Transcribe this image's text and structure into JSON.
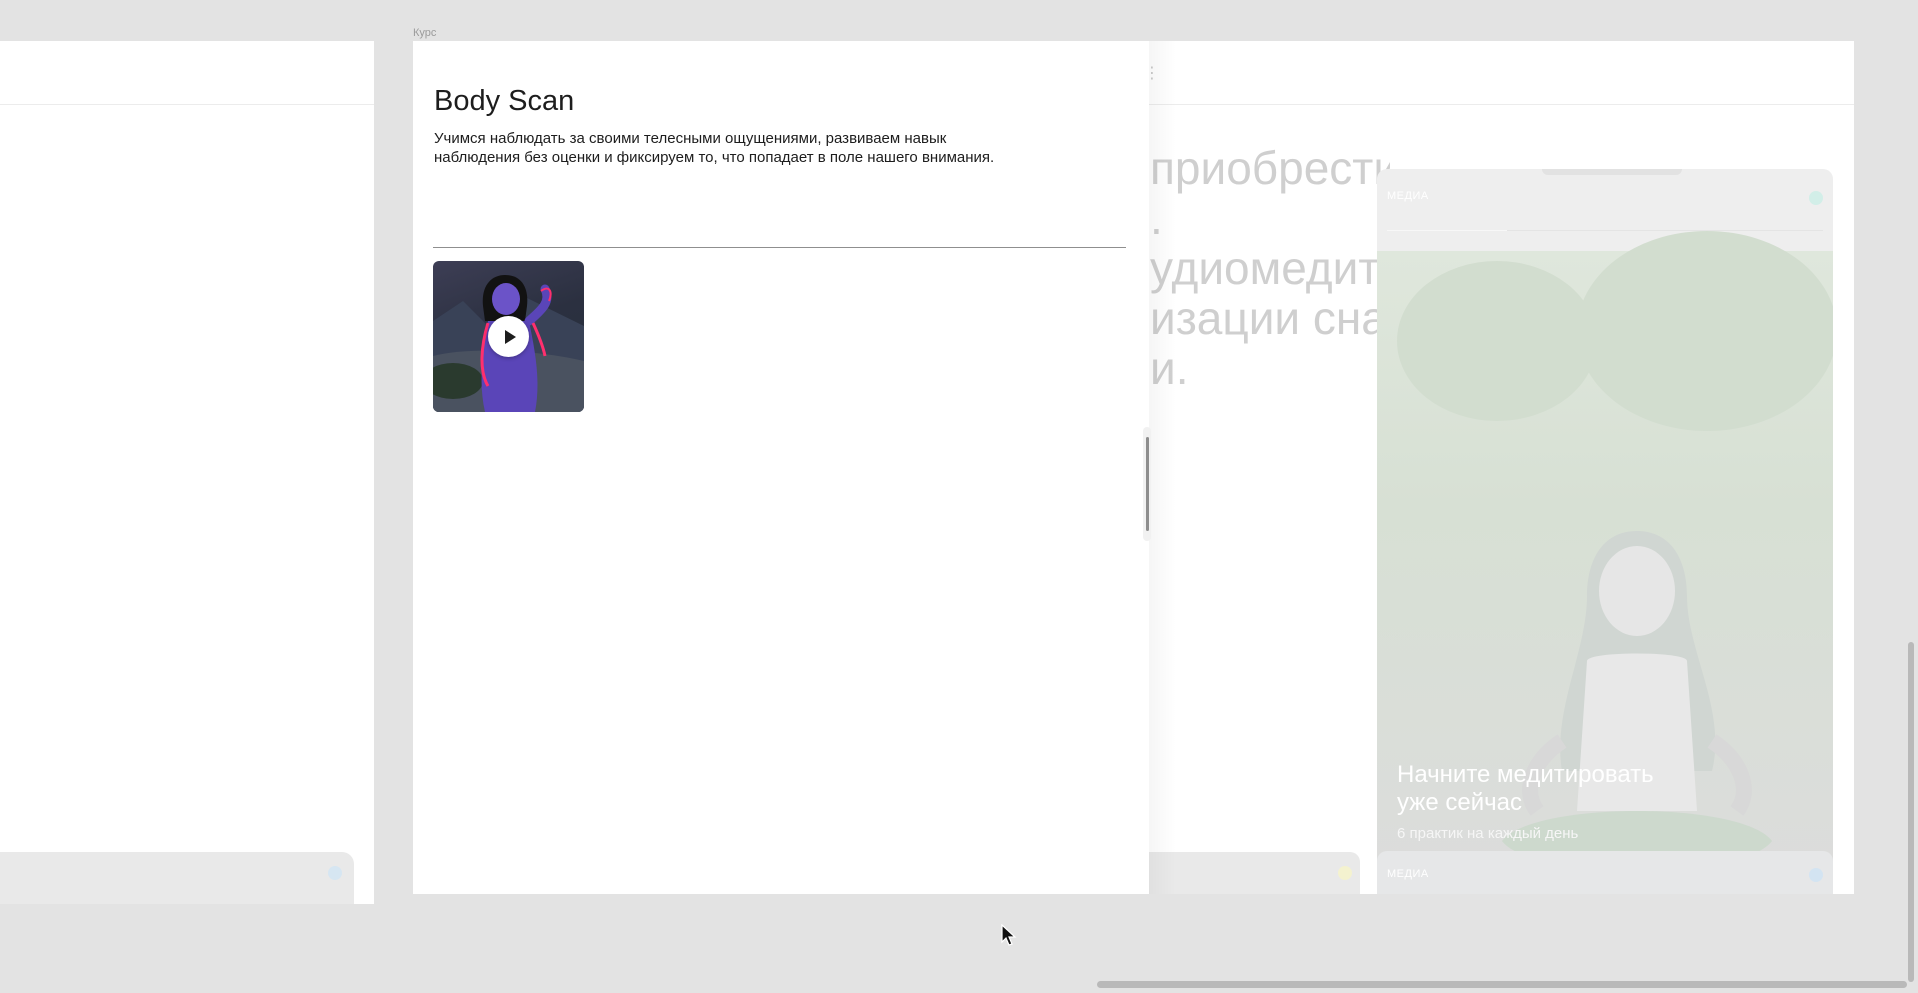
{
  "panel": {
    "caption": "Курс",
    "title": "Body Scan",
    "description": "Учимся наблюдать за своими телесными ощущениями, развиваем навык наблюдения без оценки и фиксируем то, что попадает в поле нашего внимания."
  },
  "background": {
    "text_lines": [
      "приобрести",
      ".",
      "удиомедита",
      "изации сна,",
      "и."
    ],
    "menu_glyph": "⋮",
    "media_card": {
      "label": "МЕДИА",
      "headline": "Начните медитировать уже сейчас",
      "subline": "6 практик на каждый день",
      "second_label": "МЕДИА"
    }
  },
  "icons": {
    "video_play": "play-icon",
    "pointer": "cursor-arrow-icon"
  },
  "colors": {
    "page_bg": "#e3e3e3",
    "panel_bg": "#ffffff",
    "text": "#1d1d1d",
    "muted_text": "#cfcfcf"
  }
}
